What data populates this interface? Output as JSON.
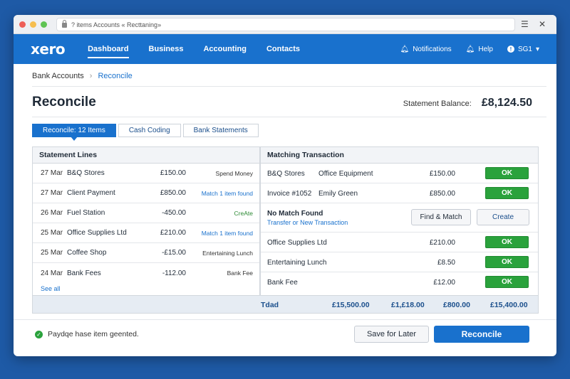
{
  "browser": {
    "address": "? items Accounts « Recttaning»",
    "menu_icon": "hamburger-icon",
    "close_icon": "close-icon"
  },
  "nav": {
    "logo": "xero",
    "items": [
      {
        "label": "Dashboard",
        "active": true
      },
      {
        "label": "Business",
        "active": false
      },
      {
        "label": "Accounting",
        "active": false
      },
      {
        "label": "Contacts",
        "active": false
      }
    ],
    "notifications": "Notifications",
    "help": "Help",
    "user": "SG1"
  },
  "breadcrumb": {
    "parent": "Bank Accounts",
    "sep": "›",
    "current": "Reconcile"
  },
  "page": {
    "title": "Reconcile",
    "statement_label": "Statement Balance:",
    "statement_value": "£8,124.50"
  },
  "tabs": [
    {
      "label": "Reconcile: 12 Items",
      "active": true
    },
    {
      "label": "Cash Coding",
      "active": false
    },
    {
      "label": "Bank Statements",
      "active": false
    }
  ],
  "statement_lines": {
    "header": "Statement Lines",
    "rows": [
      {
        "date": "27 Mar",
        "name": "B&Q Stores",
        "amount": "£150.00",
        "status": "Spend Money",
        "kind": "plain"
      },
      {
        "date": "27 Mar",
        "name": "Client Payment",
        "amount": "£850.00",
        "status": "Match 1 item found",
        "kind": "blue"
      },
      {
        "date": "26 Mar",
        "name": "Fuel Station",
        "amount": "-450.00",
        "status": "CreAte",
        "kind": "green"
      },
      {
        "date": "25 Mar",
        "name": "Office Supplies Ltd",
        "amount": "£210.00",
        "status": "Match 1 item found",
        "kind": "blue"
      },
      {
        "date": "25 Mar",
        "name": "Coffee Shop",
        "amount": "-£15.00",
        "status": "Entertaining Lunch",
        "kind": "plain"
      },
      {
        "date": "24 Mar",
        "name": "Bank Fees",
        "amount": "-112.00",
        "status": "Bank Fee",
        "kind": "plain"
      }
    ],
    "see_all": "See all"
  },
  "matching": {
    "header": "Matching Transaction",
    "ok_label": "OK",
    "rows": [
      {
        "t1": "B&Q Stores",
        "t2": "Office Equipment",
        "amount": "£150.00"
      },
      {
        "t1": "Invoice #1052",
        "t2": "Emily Green",
        "amount": "£850.00"
      },
      {
        "t1": "Office Supplies Ltd",
        "t2": "",
        "amount": "£210.00"
      },
      {
        "t1": "Entertaining Lunch",
        "t2": "",
        "amount": "£8.50"
      },
      {
        "t1": "Bank Fee",
        "t2": "",
        "amount": "£12.00"
      }
    ],
    "no_match": {
      "title": "No Match Found",
      "link": "Transfer or New Transaction",
      "find_button": "Find & Match",
      "create_button": "Create"
    }
  },
  "totals": {
    "label": "Tdad",
    "values": [
      "£15,500.00",
      "£1,£18.00",
      "£800.00",
      "£15,400.00"
    ]
  },
  "footer": {
    "status_text": "Paydqe hase item geented.",
    "save_later": "Save for Later",
    "reconcile": "Reconcile"
  },
  "colors": {
    "background": "#1e5aa6",
    "brand": "#1971cd",
    "ok_green": "#2aa23c"
  }
}
